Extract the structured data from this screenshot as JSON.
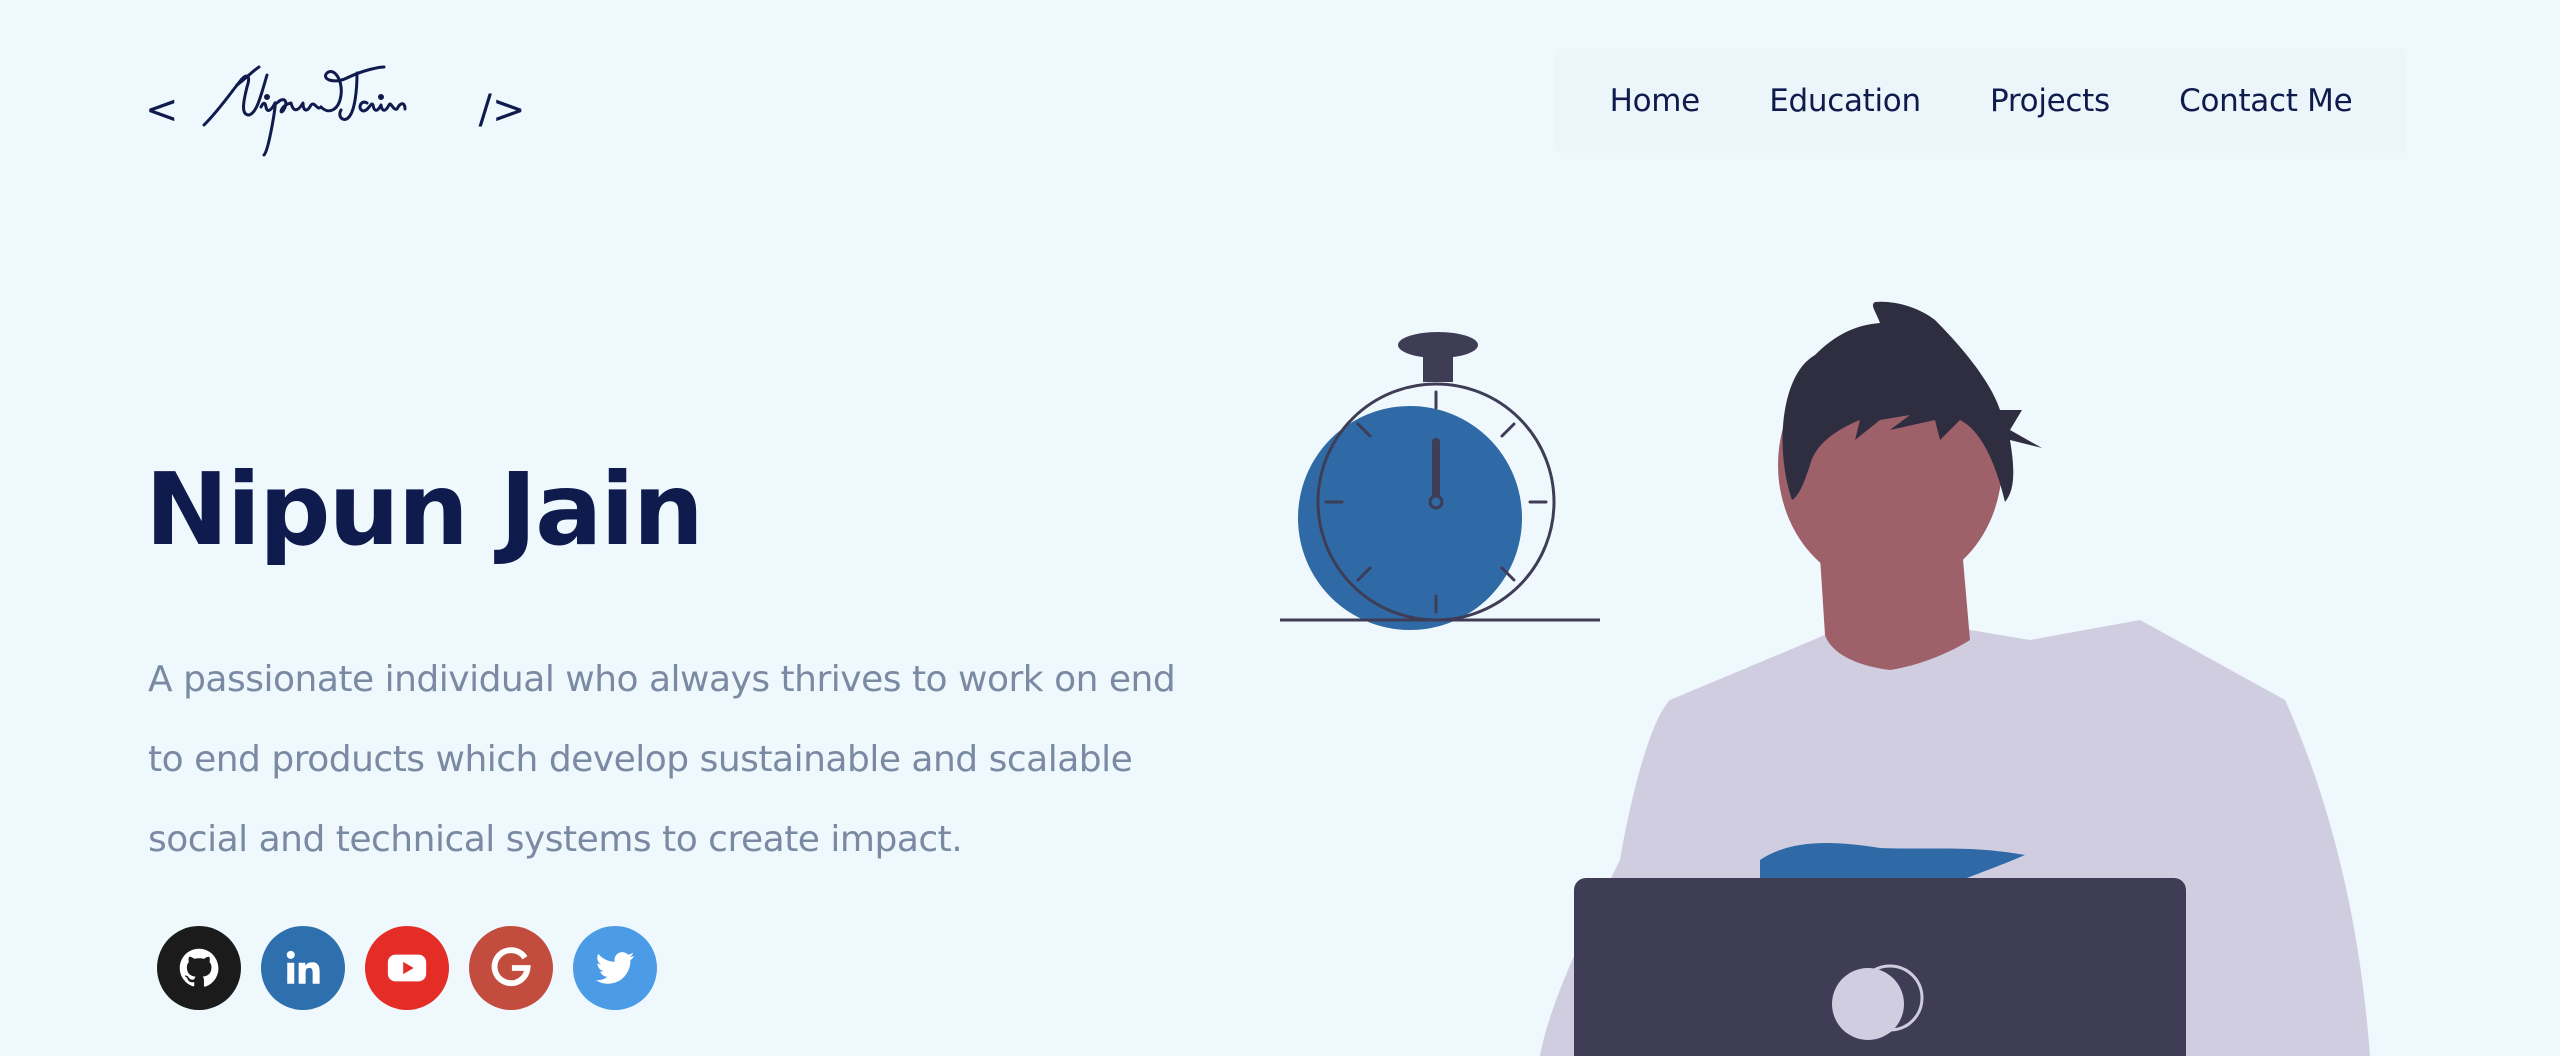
{
  "header": {
    "logo": {
      "open_bracket": "<",
      "signature_text": "Nipun Jain",
      "close_bracket": "/>"
    },
    "nav": [
      {
        "label": "Home"
      },
      {
        "label": "Education"
      },
      {
        "label": "Projects"
      },
      {
        "label": "Contact Me"
      }
    ]
  },
  "hero": {
    "title": "Nipun Jain",
    "subtitle": "A passionate individual who always thrives to work on end to end products which develop sustainable and scalable social and technical systems to create impact."
  },
  "socials": [
    {
      "name": "github",
      "icon": "github-icon",
      "color": "#1b1b1b"
    },
    {
      "name": "linkedin",
      "icon": "linkedin-icon",
      "color": "#2e6fae"
    },
    {
      "name": "youtube",
      "icon": "youtube-icon",
      "color": "#e52d27"
    },
    {
      "name": "google",
      "icon": "google-icon",
      "color": "#c24d3f"
    },
    {
      "name": "twitter",
      "icon": "twitter-icon",
      "color": "#4b9be6"
    }
  ],
  "colors": {
    "background": "#eff8fc",
    "primary_text": "#0f1b4c",
    "secondary_text": "#7a8aa3",
    "accent": "#2f6aa6",
    "laptop": "#3f3d56",
    "shirt": "#d0cde1",
    "skin": "#9e616a",
    "hair": "#2f2e41"
  }
}
